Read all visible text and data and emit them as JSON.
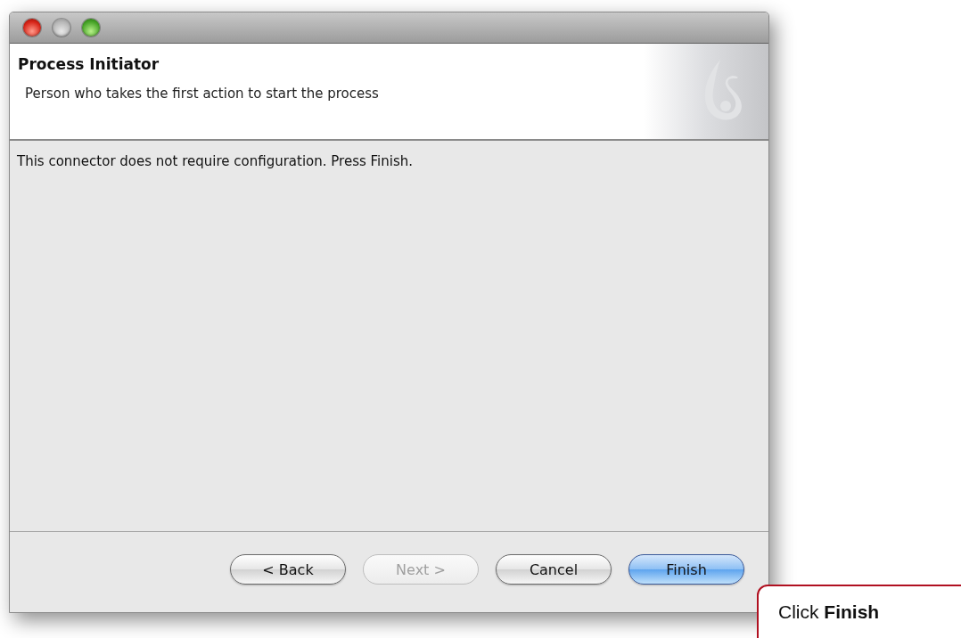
{
  "window": {
    "header_title": "Process Initiator",
    "header_subtitle": "Person who takes the first action to start the process"
  },
  "message": "This connector does not require configuration. Press Finish.",
  "buttons": [
    {
      "label": "< Back",
      "disabled": false,
      "default": false
    },
    {
      "label": "Next >",
      "disabled": true,
      "default": false
    },
    {
      "label": "Cancel",
      "disabled": false,
      "default": false
    },
    {
      "label": "Finish",
      "disabled": false,
      "default": true
    }
  ],
  "callout": {
    "text": "Click **Finish**"
  }
}
